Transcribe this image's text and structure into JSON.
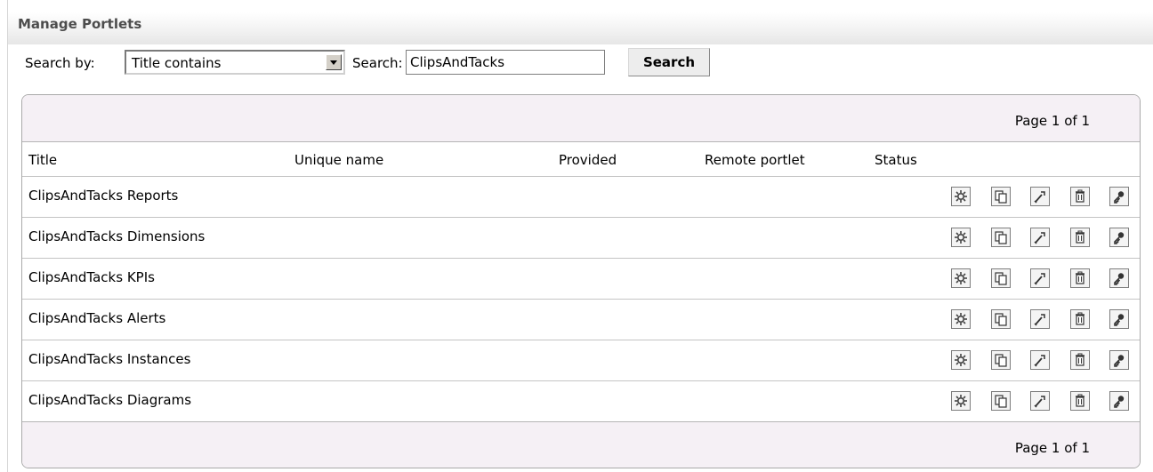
{
  "page": {
    "title": "Manage Portlets"
  },
  "search": {
    "search_by_label": "Search by:",
    "search_by_value": "Title contains",
    "search_label": "Search:",
    "search_value": "ClipsAndTacks",
    "search_button": "Search"
  },
  "pager": {
    "top_text": "Page 1 of 1",
    "bottom_text": "Page 1 of 1"
  },
  "columns": [
    "Title",
    "Unique name",
    "Provided",
    "Remote portlet",
    "Status"
  ],
  "rows": [
    {
      "title": "ClipsAndTacks Reports"
    },
    {
      "title": "ClipsAndTacks Dimensions"
    },
    {
      "title": "ClipsAndTacks KPIs"
    },
    {
      "title": "ClipsAndTacks Alerts"
    },
    {
      "title": "ClipsAndTacks Instances"
    },
    {
      "title": "ClipsAndTacks Diagrams"
    }
  ],
  "row_actions": [
    "settings-icon",
    "copy-icon",
    "wrench-icon",
    "trash-icon",
    "key-icon"
  ]
}
